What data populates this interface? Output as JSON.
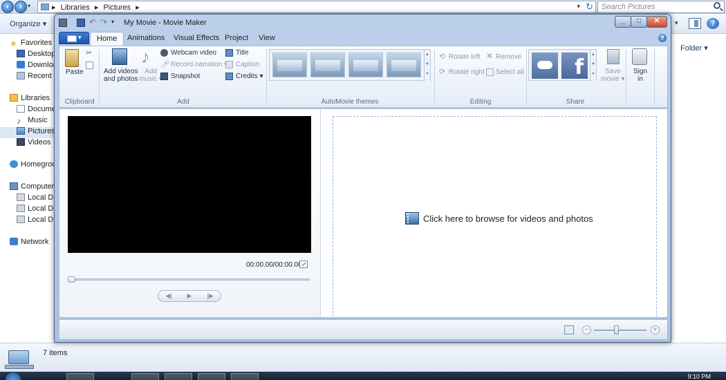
{
  "explorer": {
    "address_crumbs": [
      "Libraries",
      "Pictures"
    ],
    "search_placeholder": "Search Pictures",
    "organize_label": "Organize ▾",
    "folder_label": "Folder ▾",
    "help_label": "?",
    "nav_items": [
      {
        "label": "Favorites",
        "icon": "star-icon"
      },
      {
        "label": "Desktop",
        "icon": "desktop-icon"
      },
      {
        "label": "Downloads",
        "icon": "downloads-icon"
      },
      {
        "label": "Recent Places",
        "icon": "recent-places-icon"
      },
      {
        "label": "Libraries",
        "icon": "libraries-icon"
      },
      {
        "label": "Documents",
        "icon": "documents-icon"
      },
      {
        "label": "Music",
        "icon": "music-icon"
      },
      {
        "label": "Pictures",
        "icon": "pictures-icon"
      },
      {
        "label": "Videos",
        "icon": "videos-icon"
      },
      {
        "label": "Homegroup",
        "icon": "homegroup-icon"
      },
      {
        "label": "Computer",
        "icon": "computer-icon"
      },
      {
        "label": "Local Disk",
        "icon": "disk-icon"
      },
      {
        "label": "Local Disk",
        "icon": "disk-icon"
      },
      {
        "label": "Local Disk",
        "icon": "disk-icon"
      },
      {
        "label": "Network",
        "icon": "network-icon"
      }
    ],
    "status_count": "7 items",
    "clock": "9:10 PM"
  },
  "moviemaker": {
    "title": "My Movie - Movie Maker",
    "tabs": [
      "Home",
      "Animations",
      "Visual Effects",
      "Project",
      "View"
    ],
    "clipboard": {
      "paste": "Paste",
      "group": "Clipboard"
    },
    "add": {
      "add_videos_line1": "Add videos",
      "add_videos_line2": "and photos",
      "add_music_line1": "Add",
      "add_music_line2": "music ▾",
      "webcam": "Webcam video",
      "record_narration": "Record narration ▾",
      "snapshot": "Snapshot",
      "title": "Title",
      "caption": "Caption",
      "credits": "Credits ▾",
      "group": "Add"
    },
    "automovie": {
      "group": "AutoMovie themes"
    },
    "editing": {
      "rotate_left": "Rotate left",
      "rotate_right": "Rotate right",
      "remove": "Remove",
      "select_all": "Select all",
      "group": "Editing"
    },
    "share": {
      "save_movie_line1": "Save",
      "save_movie_line2": "movie ▾",
      "sign_in_line1": "Sign",
      "sign_in_line2": "in",
      "group": "Share",
      "facebook_glyph": "f"
    },
    "preview": {
      "timecode": "00:00.00/00:00.00"
    },
    "storyboard": {
      "browse_text": "Click here to browse for videos and photos"
    }
  }
}
